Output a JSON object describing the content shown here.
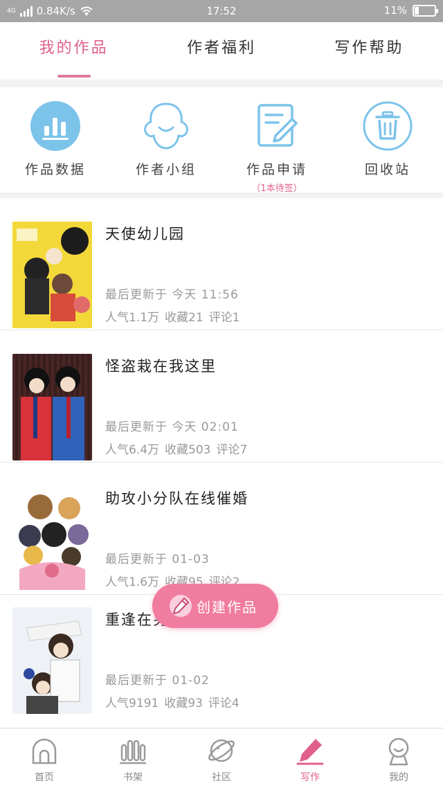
{
  "status": {
    "network": "4G",
    "speed": "0.84K/s",
    "time": "17:52",
    "battery": "11%"
  },
  "tabs": [
    {
      "label": "我的作品",
      "active": true
    },
    {
      "label": "作者福利",
      "active": false
    },
    {
      "label": "写作帮助",
      "active": false
    }
  ],
  "quick": [
    {
      "label": "作品数据",
      "sub": "",
      "icon": "bar-chart-icon"
    },
    {
      "label": "作者小组",
      "sub": "",
      "icon": "group-icon"
    },
    {
      "label": "作品申请",
      "sub": "（1本待签）",
      "icon": "edit-document-icon"
    },
    {
      "label": "回收站",
      "sub": "",
      "icon": "trash-icon"
    }
  ],
  "works": [
    {
      "title": "天使幼儿园",
      "updated": "最后更新于 今天 11:56",
      "popularity": "人气1.1万",
      "favorites": "收藏21",
      "comments": "评论1"
    },
    {
      "title": "怪盗栽在我这里",
      "updated": "最后更新于 今天 02:01",
      "popularity": "人气6.4万",
      "favorites": "收藏503",
      "comments": "评论7"
    },
    {
      "title": "助攻小分队在线催婚",
      "updated": "最后更新于 01-03",
      "popularity": "人气1.6万",
      "favorites": "收藏95",
      "comments": "评论2"
    },
    {
      "title": "重逢在另一个时空",
      "updated": "最后更新于 01-02",
      "popularity": "人气9191",
      "favorites": "收藏93",
      "comments": "评论4"
    }
  ],
  "fab": {
    "label": "创建作品"
  },
  "nav": [
    {
      "label": "首页",
      "icon": "home-icon",
      "active": false
    },
    {
      "label": "书架",
      "icon": "bookshelf-icon",
      "active": false
    },
    {
      "label": "社区",
      "icon": "planet-icon",
      "active": false
    },
    {
      "label": "写作",
      "icon": "pen-icon",
      "active": true
    },
    {
      "label": "我的",
      "icon": "profile-icon",
      "active": false
    }
  ],
  "colors": {
    "accent": "#e0608a",
    "fab": "#f07ca0",
    "iconBlue": "#7cc3ea"
  }
}
